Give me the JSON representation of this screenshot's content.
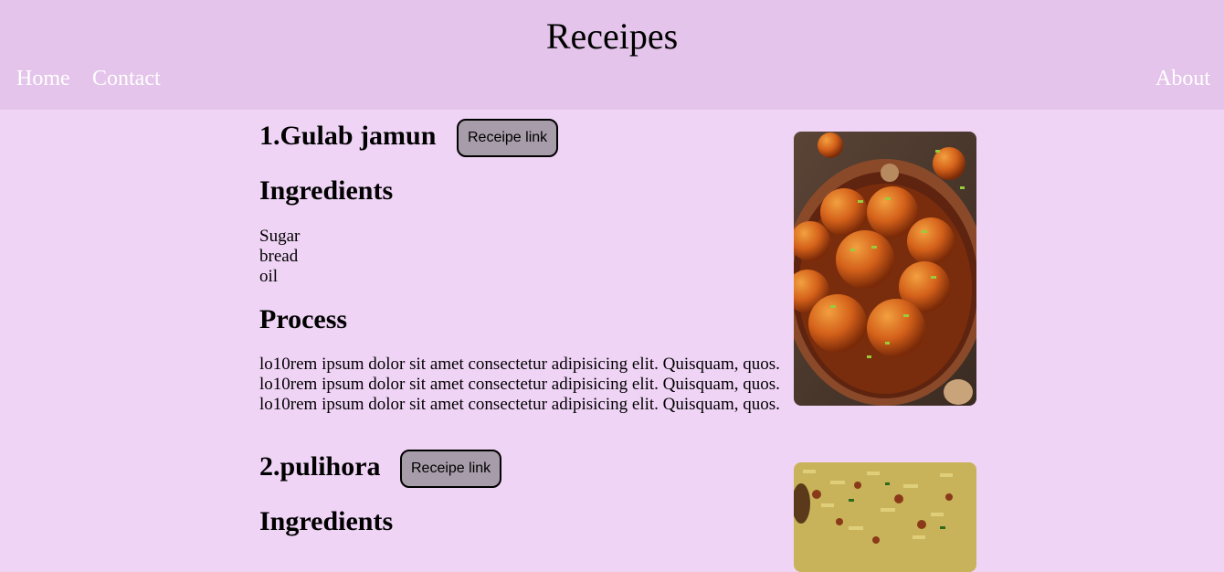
{
  "header": {
    "title": "Receipes"
  },
  "nav": {
    "home": "Home",
    "contact": "Contact",
    "about": "About"
  },
  "recipes": [
    {
      "title": "1.Gulab jamun",
      "link_label": "Receipe link",
      "ingredients_heading": "Ingredients",
      "ingredients": [
        "Sugar",
        "bread",
        "oil"
      ],
      "process_heading": "Process",
      "process": [
        "lo10rem ipsum dolor sit amet consectetur adipisicing elit. Quisquam, quos.",
        "lo10rem ipsum dolor sit amet consectetur adipisicing elit. Quisquam, quos.",
        "lo10rem ipsum dolor sit amet consectetur adipisicing elit. Quisquam, quos."
      ]
    },
    {
      "title": "2.pulihora",
      "link_label": "Receipe link",
      "ingredients_heading": "Ingredients"
    }
  ],
  "colors": {
    "page_background": "#f0d4f6",
    "header_background": "#e4c4ea",
    "button_background": "#a79ca9",
    "nav_text": "#ffffff"
  }
}
